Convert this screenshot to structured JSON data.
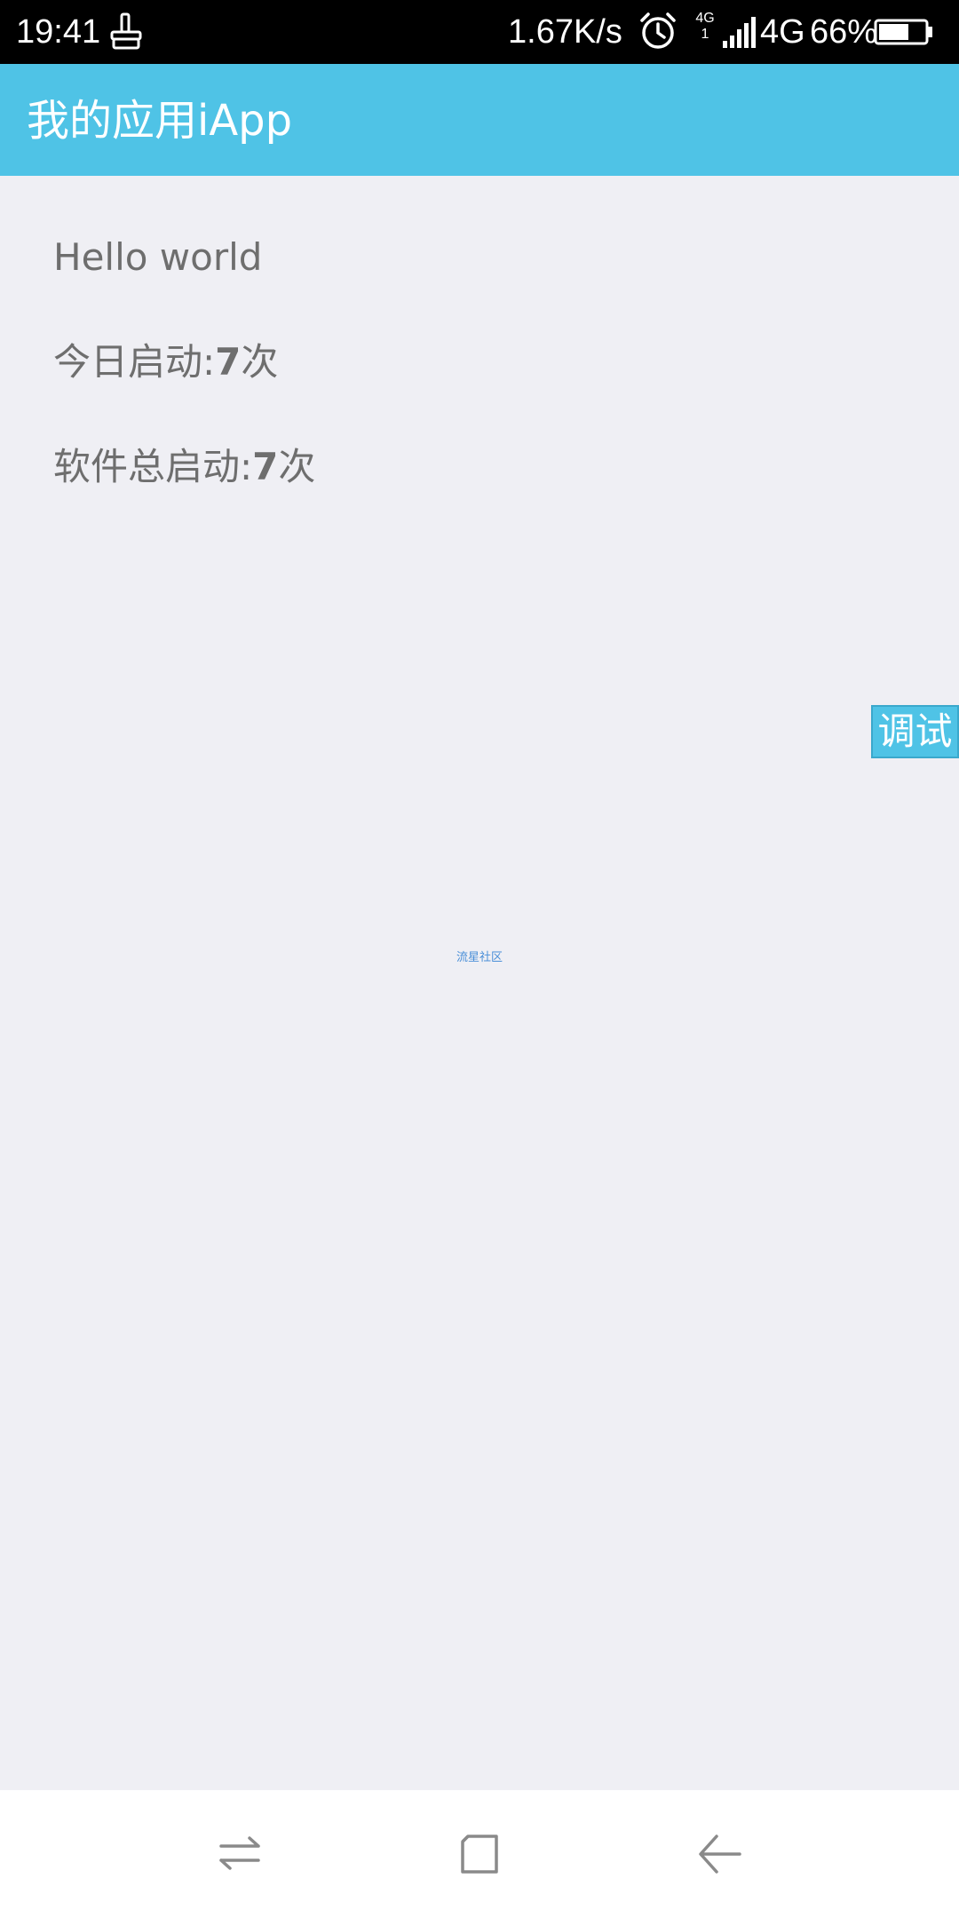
{
  "status_bar": {
    "time": "19:41",
    "speed": "1.67K/s",
    "small_network_top": "4G",
    "small_network_bottom": "1",
    "network": "4G",
    "battery_percent": "66%",
    "battery_level": 0.66,
    "icons": [
      "notification-icon",
      "alarm-icon",
      "signal-icon",
      "battery-icon"
    ]
  },
  "app_bar": {
    "title": "我的应用iApp",
    "color": "#4fc3e6"
  },
  "content": {
    "hello": "Hello world",
    "today_prefix": "今日启动:",
    "today_count": "7",
    "today_suffix": "次",
    "total_prefix": "软件总启动:",
    "total_count": "7",
    "total_suffix": "次"
  },
  "debug_button": {
    "label": "调试"
  },
  "community_link": {
    "label": "流星社区"
  },
  "nav_bar": {
    "icons": [
      "switch-apps-icon",
      "home-icon",
      "back-icon"
    ]
  }
}
